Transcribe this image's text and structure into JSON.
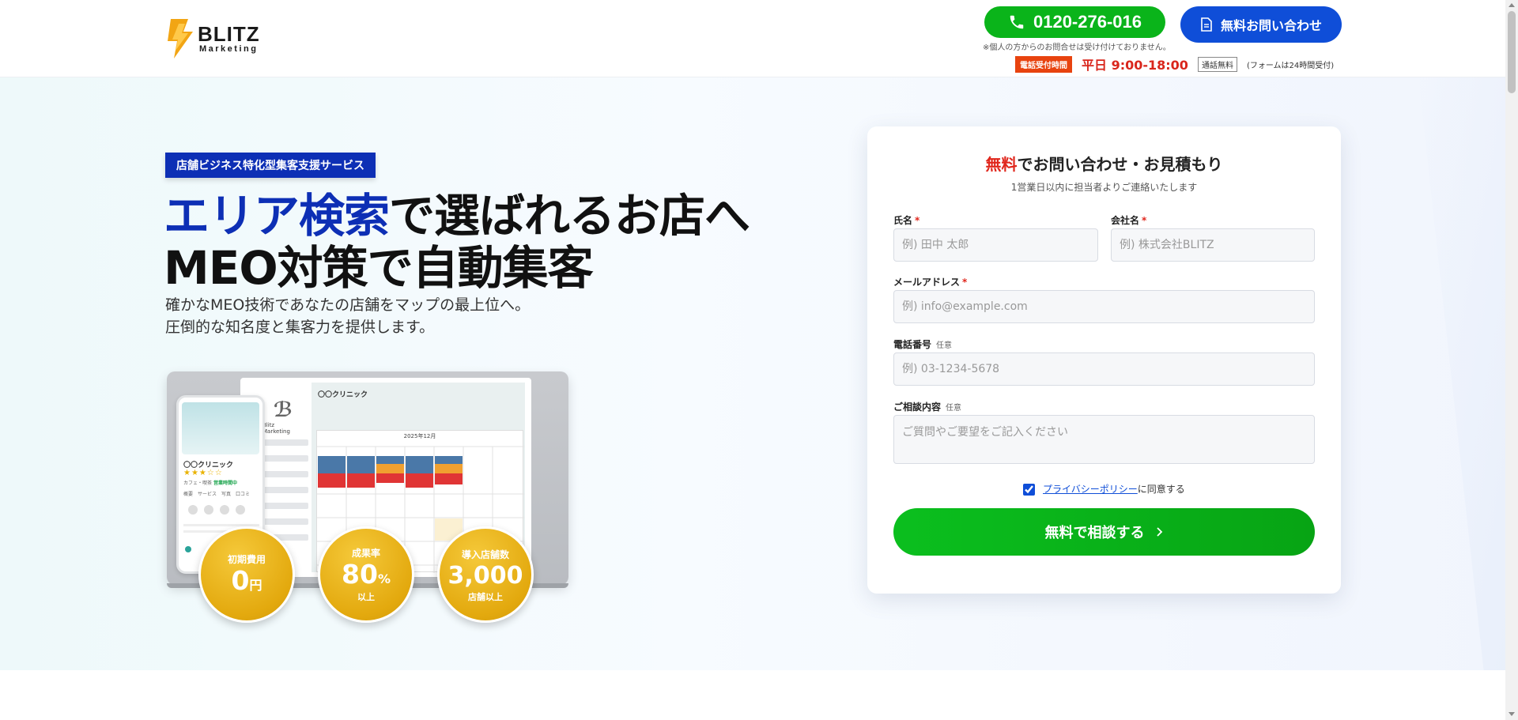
{
  "header": {
    "logo": {
      "name": "BLITZ",
      "sub": "Marketing"
    },
    "phone_button": {
      "number": "0120-276-016",
      "icon": "phone-icon"
    },
    "contact_button": {
      "label": "無料お問い合わせ",
      "icon": "document-icon"
    },
    "phone_note": "※個人の方からのお問合せは受け付けておりません。",
    "hours_badge": "電話受付時間",
    "hours_text": "平日 9:00-18:00",
    "free_badge": "通話無料",
    "hours_note": "(フォームは24時間受付)"
  },
  "hero": {
    "tagline": "店舗ビジネス特化型集客支援サービス",
    "headline_accent": "エリア検索",
    "headline_rest": "で選ばれるお店へ",
    "headline_line2": "MEO対策で自動集客",
    "subcopy_line1": "確かなMEO技術であなたの店舗をマップの最上位へ。",
    "subcopy_line2": "圧倒的な知名度と集客力を提供します。",
    "mockup": {
      "screen_logo_text": "Blitz Marketing",
      "screen_title": "〇〇クリニック",
      "calendar_month": "2025年12月",
      "phone_name": "〇〇クリニック",
      "phone_stars": "★★★☆☆",
      "phone_meta_prefix": "カフェ・喫茶",
      "phone_meta_status": "営業時間中",
      "phone_tabs": "概要　サービス　写真　口コミ"
    },
    "stats": [
      {
        "label": "初期費用",
        "value": "0",
        "unit": "円",
        "sub": ""
      },
      {
        "label": "成果率",
        "value": "80",
        "unit": "%",
        "sub": "以上"
      },
      {
        "label": "導入店舗数",
        "value": "3,000",
        "unit": "",
        "sub": "店舗以上"
      }
    ]
  },
  "form": {
    "title_accent": "無料",
    "title_rest": "でお問い合わせ・お見積もり",
    "subtitle": "1営業日以内に担当者よりご連絡いたします",
    "name": {
      "label": "氏名",
      "required": "*",
      "placeholder": "例) 田中 太郎"
    },
    "company": {
      "label": "会社名",
      "required": "*",
      "placeholder": "例) 株式会社BLITZ"
    },
    "email": {
      "label": "メールアドレス",
      "required": "*",
      "placeholder": "例) info@example.com"
    },
    "phone": {
      "label": "電話番号",
      "optional": "任意",
      "placeholder": "例) 03-1234-5678"
    },
    "message": {
      "label": "ご相談内容",
      "optional": "任意",
      "placeholder": "ご質問やご要望をご記入ください"
    },
    "privacy_link": "プライバシーポリシー",
    "privacy_suffix": "に同意する",
    "privacy_checked": true,
    "submit_label": "無料で相談する",
    "submit_icon": "chevron-right-icon"
  },
  "colors": {
    "brand_blue": "#0d2fb5",
    "cta_green": "#0ab41a",
    "contact_blue": "#0f4ed8",
    "accent_red": "#e0261c",
    "gold": "#e3a90e"
  }
}
